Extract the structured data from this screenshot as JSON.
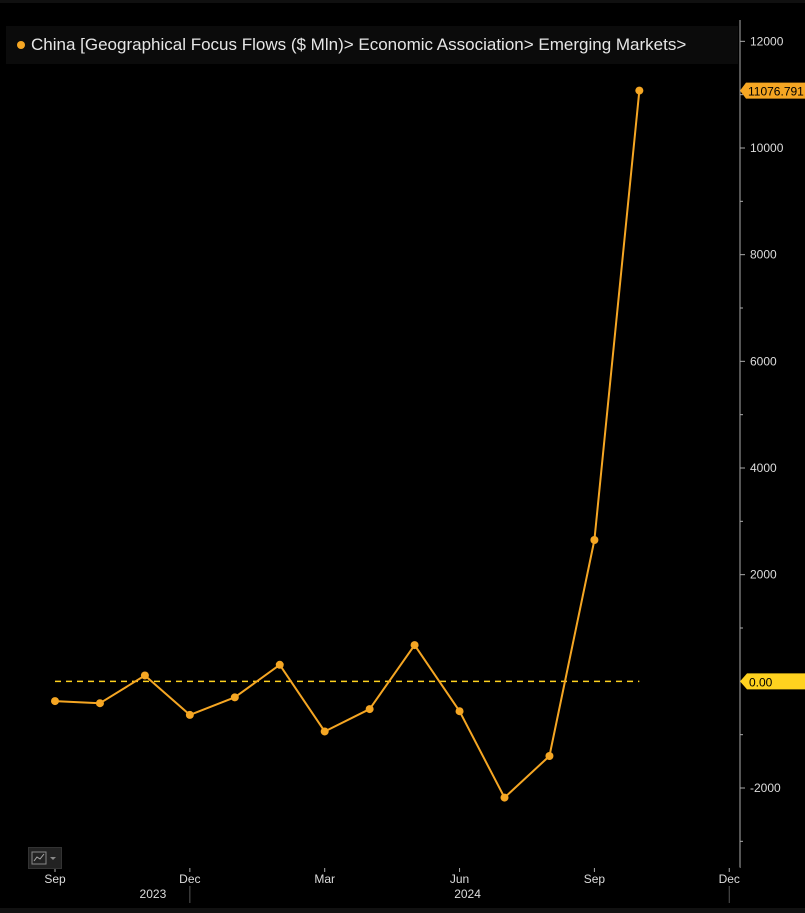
{
  "legend": {
    "label": "China [Geographical Focus Flows ($ Mln)> Economic Association> Emerging Markets>",
    "color": "#f5a623"
  },
  "icons": {
    "chart_type": "line-chart-icon"
  },
  "chart_data": {
    "type": "line",
    "series": [
      {
        "name": "China [Geographical Focus Flows ($ Mln)> Economic Association> Emerging Markets>",
        "color": "#f5a623",
        "x": [
          "2023-09",
          "2023-10",
          "2023-11",
          "2023-12",
          "2024-01",
          "2024-02",
          "2024-03",
          "2024-04",
          "2024-05",
          "2024-06",
          "2024-07",
          "2024-08",
          "2024-09",
          "2024-10"
        ],
        "values": [
          -370,
          -410,
          110,
          -630,
          -300,
          310,
          -940,
          -520,
          680,
          -560,
          -2180,
          -1400,
          2650,
          11076.791
        ]
      }
    ],
    "ylim": [
      -3500,
      12400
    ],
    "yticks": [
      -2000,
      2000,
      4000,
      6000,
      8000,
      10000,
      12000
    ],
    "xticks": [
      {
        "date": "2023-09",
        "label": "Sep"
      },
      {
        "date": "2023-12",
        "label": "Dec"
      },
      {
        "date": "2024-03",
        "label": "Mar"
      },
      {
        "date": "2024-06",
        "label": "Jun"
      },
      {
        "date": "2024-09",
        "label": "Sep"
      },
      {
        "date": "2024-12",
        "label": "Dec"
      }
    ],
    "years": [
      {
        "label": "2023",
        "center": "2023-11"
      },
      {
        "label": "2024",
        "center": "2024-06"
      }
    ],
    "reference_line": {
      "value": 0,
      "label": "0.00",
      "color": "#ffd21f",
      "style": "dashed"
    },
    "last_value_label": "11076.791",
    "grid": false
  }
}
